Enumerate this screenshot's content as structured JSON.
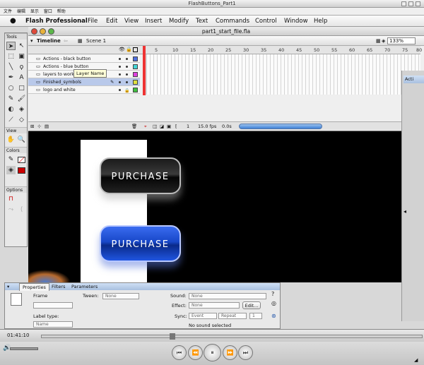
{
  "player": {
    "title": "FlashButtons_Part1",
    "menu": [
      "文件",
      "编辑",
      "显示",
      "窗口",
      "帮助"
    ],
    "time": "01:41:10"
  },
  "menubar": {
    "apple": "",
    "app": "Flash Professional",
    "items": [
      "File",
      "Edit",
      "View",
      "Insert",
      "Modify",
      "Text",
      "Commands",
      "Control",
      "Window",
      "Help"
    ]
  },
  "document": {
    "title": "part1_start_file.fla",
    "scene": "Scene 1",
    "zoom": "133%"
  },
  "tools": {
    "heading": "Tools",
    "view_heading": "View",
    "colors_heading": "Colors",
    "options_heading": "Options",
    "stroke_color": "#000000",
    "fill_color": "#cc0000"
  },
  "timeline": {
    "tab": "Timeline",
    "ticks": [
      "1",
      "5",
      "10",
      "15",
      "20",
      "25",
      "30",
      "35",
      "40",
      "45",
      "50",
      "55",
      "60",
      "65",
      "70",
      "75",
      "80"
    ],
    "layers": [
      {
        "name": "Actions - black button",
        "color": "#4f6fe0"
      },
      {
        "name": "Actions - blue button",
        "color": "#44d6d6"
      },
      {
        "name": "layers to work with",
        "color": "#e040e0"
      },
      {
        "name": "Finished_symbols",
        "color": "#e0e040"
      },
      {
        "name": "logo and white",
        "color": "#40c040"
      }
    ],
    "tooltip": "Layer Name",
    "status": {
      "frame": "1",
      "fps": "15.0 fps",
      "time": "0.0s"
    }
  },
  "stage": {
    "buttons": [
      "PURCHASE",
      "PURCHASE"
    ]
  },
  "properties": {
    "tabs": [
      "Properties",
      "Filters",
      "Parameters"
    ],
    "frame_label": "Frame",
    "tween_label": "Tween:",
    "tween_value": "None",
    "label_type_label": "Label type:",
    "label_type_value": "Name",
    "sound_label": "Sound:",
    "sound_value": "None",
    "effect_label": "Effect:",
    "effect_value": "None",
    "edit_label": "Edit...",
    "sync_label": "Sync:",
    "sync_value": "Event",
    "repeat_value": "Repeat",
    "repeat_count": "1",
    "status": "No sound selected"
  },
  "right_panel": {
    "tab": "Acti"
  }
}
